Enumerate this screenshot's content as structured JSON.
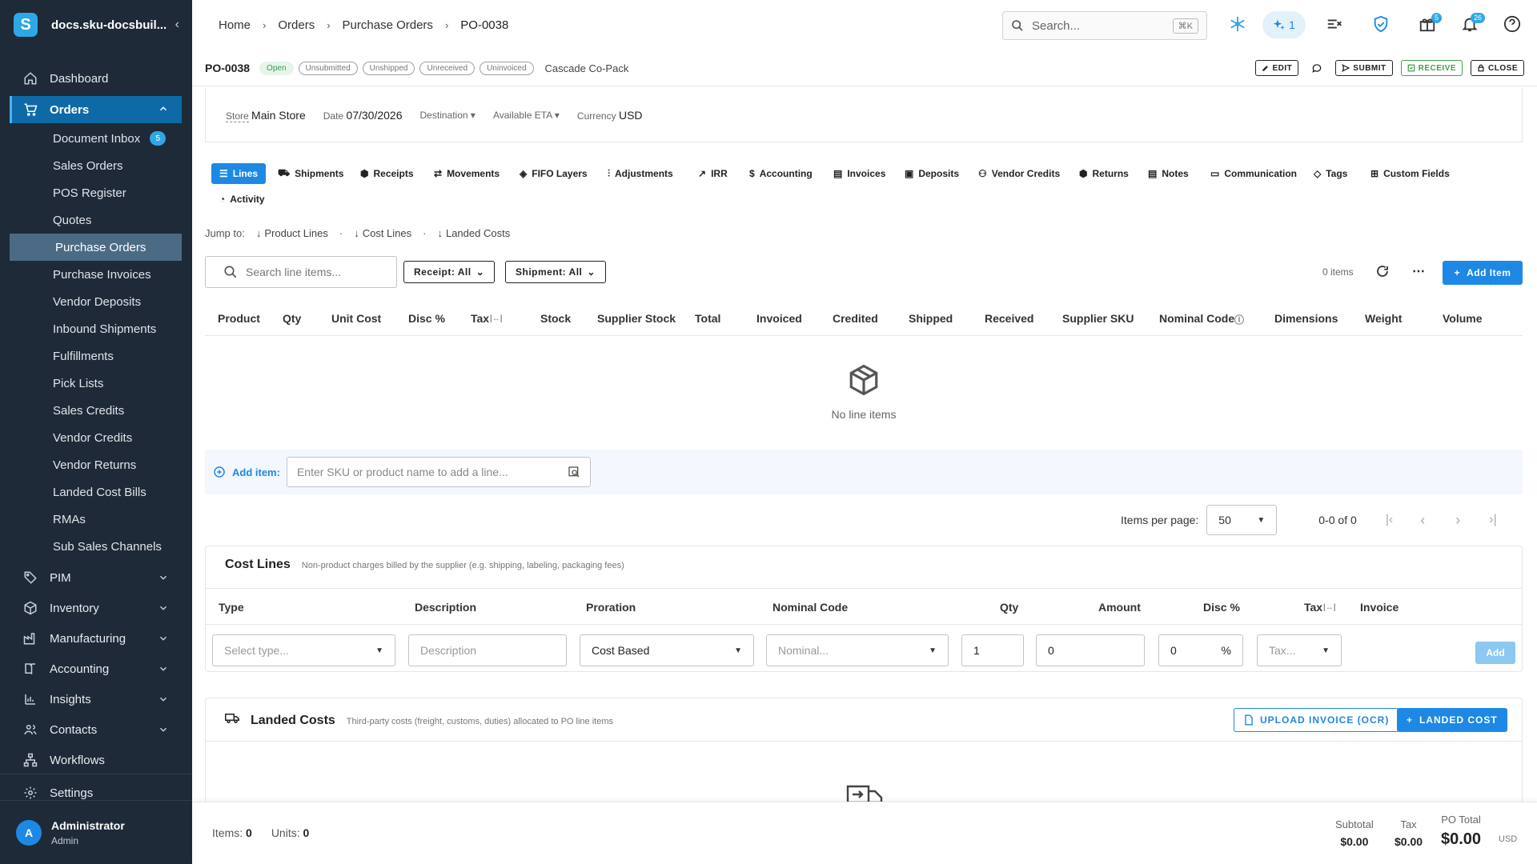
{
  "sidebar": {
    "org": "docs.sku-docsbuil...",
    "items": [
      {
        "label": "Dashboard"
      },
      {
        "label": "Orders"
      },
      {
        "label": "PIM"
      },
      {
        "label": "Inventory"
      },
      {
        "label": "Manufacturing"
      },
      {
        "label": "Accounting"
      },
      {
        "label": "Insights"
      },
      {
        "label": "Contacts"
      },
      {
        "label": "Workflows"
      },
      {
        "label": "Settings"
      }
    ],
    "orders_sub": [
      {
        "label": "Document Inbox",
        "count": "5"
      },
      {
        "label": "Sales Orders"
      },
      {
        "label": "POS Register"
      },
      {
        "label": "Quotes"
      },
      {
        "label": "Purchase Orders"
      },
      {
        "label": "Purchase Invoices"
      },
      {
        "label": "Vendor Deposits"
      },
      {
        "label": "Inbound Shipments"
      },
      {
        "label": "Fulfillments"
      },
      {
        "label": "Pick Lists"
      },
      {
        "label": "Sales Credits"
      },
      {
        "label": "Vendor Credits"
      },
      {
        "label": "Vendor Returns"
      },
      {
        "label": "Landed Cost Bills"
      },
      {
        "label": "RMAs"
      },
      {
        "label": "Sub Sales Channels"
      }
    ],
    "user": {
      "initial": "A",
      "name": "Administrator",
      "role": "Admin"
    }
  },
  "topbar": {
    "breadcrumbs": [
      "Home",
      "Orders",
      "Purchase Orders",
      "PO-0038"
    ],
    "search_placeholder": "Search...",
    "search_kbd": "⌘K",
    "ai_count": "1",
    "gift_badge": "5",
    "bell_badge": "26"
  },
  "po": {
    "id": "PO-0038",
    "statuses": [
      "Open",
      "Unsubmitted",
      "Unshipped",
      "Unreceived",
      "Uninvoiced"
    ],
    "vendor": "Cascade Co-Pack",
    "actions": {
      "edit": "EDIT",
      "submit": "SUBMIT",
      "receive": "RECEIVE",
      "close": "CLOSE"
    }
  },
  "info": {
    "store_label": "Store",
    "store": "Main Store",
    "date_label": "Date",
    "date": "07/30/2026",
    "destination_label": "Destination",
    "eta_label": "Available ETA",
    "currency_label": "Currency",
    "currency": "USD"
  },
  "tabs": [
    "Lines",
    "Shipments",
    "Receipts",
    "Movements",
    "FIFO Layers",
    "Adjustments",
    "IRR",
    "Accounting",
    "Invoices",
    "Deposits",
    "Vendor Credits",
    "Returns",
    "Notes",
    "Communication",
    "Tags",
    "Custom Fields",
    "Activity"
  ],
  "jump": {
    "label": "Jump to:",
    "links": [
      "Product Lines",
      "Cost Lines",
      "Landed Costs"
    ]
  },
  "lines_toolbar": {
    "search_placeholder": "Search line items...",
    "receipt_filter": "Receipt: All",
    "shipment_filter": "Shipment: All",
    "items_count": "0 items",
    "add_item": "Add Item"
  },
  "lines_table": {
    "columns": [
      "Product",
      "Qty",
      "Unit Cost",
      "Disc %",
      "Tax",
      "Stock",
      "Supplier Stock",
      "Total",
      "Invoiced",
      "Credited",
      "Shipped",
      "Received",
      "Supplier SKU",
      "Nominal Code",
      "Dimensions",
      "Weight",
      "Volume"
    ],
    "empty_text": "No line items",
    "add_label": "Add item:",
    "add_placeholder": "Enter SKU or product name to add a line..."
  },
  "pager": {
    "per_page_label": "Items per page:",
    "per_page": "50",
    "range": "0-0 of 0"
  },
  "cost_lines": {
    "title": "Cost Lines",
    "subtitle": "Non-product charges billed by the supplier (e.g. shipping, labeling, packaging fees)",
    "columns": [
      "Type",
      "Description",
      "Proration",
      "Nominal Code",
      "Qty",
      "Amount",
      "Disc %",
      "Tax",
      "Invoice"
    ],
    "type_placeholder": "Select type...",
    "desc_placeholder": "Description",
    "proration": "Cost Based",
    "nominal_placeholder": "Nominal...",
    "qty": "1",
    "amount": "0",
    "disc": "0",
    "disc_suffix": "%",
    "tax_placeholder": "Tax...",
    "add": "Add"
  },
  "landed_costs": {
    "title": "Landed Costs",
    "subtitle": "Third-party costs (freight, customs, duties) allocated to PO line items",
    "upload": "UPLOAD INVOICE (OCR)",
    "add": "LANDED COST"
  },
  "footer": {
    "items_label": "Items:",
    "items": "0",
    "units_label": "Units:",
    "units": "0",
    "subtotal_label": "Subtotal",
    "subtotal": "$0.00",
    "tax_label": "Tax",
    "tax": "$0.00",
    "total_label": "PO Total",
    "total": "$0.00",
    "currency": "USD"
  }
}
